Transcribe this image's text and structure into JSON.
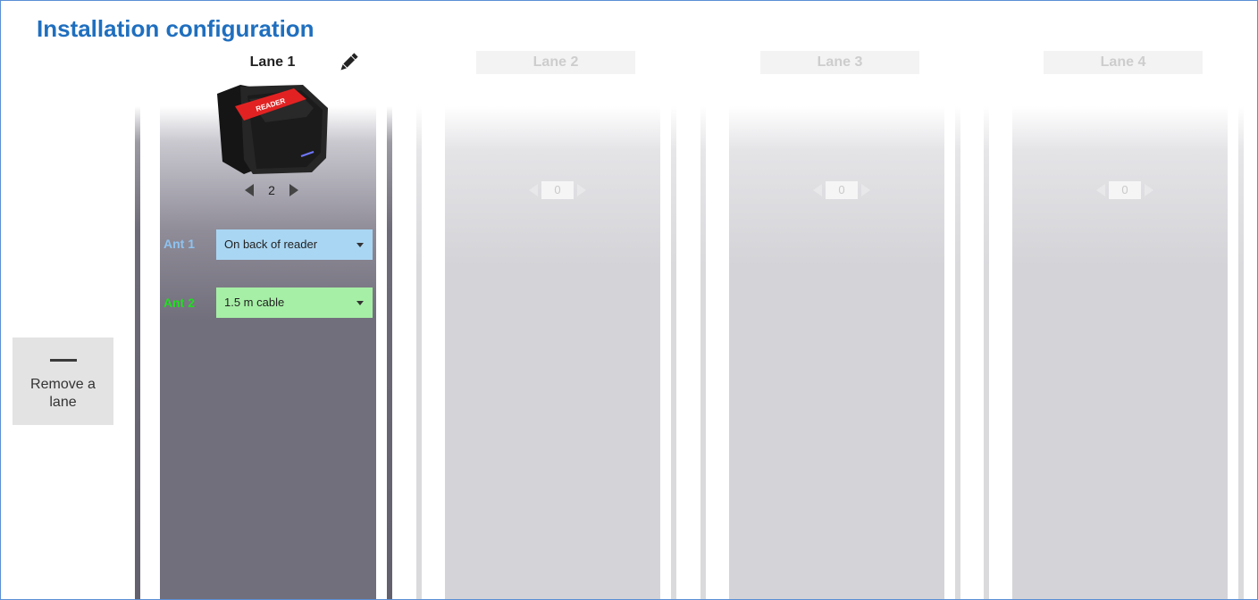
{
  "page": {
    "title": "Installation configuration"
  },
  "remove_lane": {
    "label": "Remove a lane"
  },
  "lanes": [
    {
      "title": "Lane 1",
      "count": "2",
      "ant1_label": "Ant 1",
      "ant1_value": "On back of reader",
      "ant2_label": "Ant 2",
      "ant2_value": "1.5 m cable"
    },
    {
      "title": "Lane 2",
      "count": "0"
    },
    {
      "title": "Lane 3",
      "count": "0"
    },
    {
      "title": "Lane 4",
      "count": "0"
    }
  ],
  "device": {
    "label": "READER"
  },
  "colors": {
    "title": "#1f6fbf",
    "ant1": "#a9d6f3",
    "ant2": "#a6efa6",
    "active_lane": "#726f7c",
    "inactive_lane": "#d4d4d8"
  },
  "icons": {
    "edit": "pencil-icon",
    "remove": "minus-icon",
    "prev": "arrow-left-icon",
    "next": "arrow-right-icon"
  }
}
